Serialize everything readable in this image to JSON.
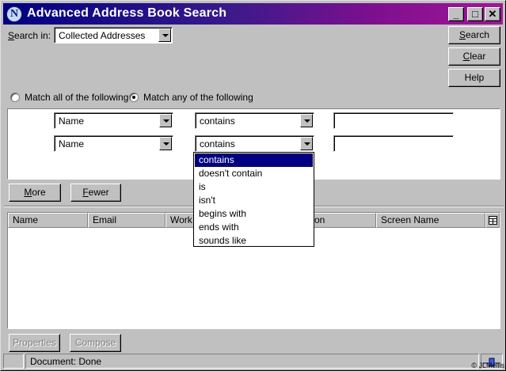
{
  "window": {
    "title": "Advanced Address Book Search",
    "app_icon_letter": "N",
    "minimize": "_",
    "maximize": "□",
    "close": "✕"
  },
  "search_in": {
    "label_prefix": "S",
    "label_rest": "earch in:",
    "value": "Collected Addresses"
  },
  "buttons": {
    "search_u": "S",
    "search_rest": "earch",
    "clear_u": "C",
    "clear_rest": "lear",
    "help": "Help",
    "more_u": "M",
    "more_rest": "ore",
    "fewer_u": "F",
    "fewer_rest": "ewer",
    "properties": "Properties",
    "compose": "Compose"
  },
  "match": {
    "all_label": "Match all of the following",
    "any_label": "Match any of the following",
    "selected": "any"
  },
  "criteria": [
    {
      "field": "Name",
      "operator": "contains",
      "value": ""
    },
    {
      "field": "Name",
      "operator": "contains",
      "value": ""
    }
  ],
  "operator_dropdown": {
    "options": [
      "contains",
      "doesn't contain",
      "is",
      "isn't",
      "begins with",
      "ends with",
      "sounds like"
    ],
    "selected_index": 0
  },
  "results": {
    "columns": [
      "Name",
      "Email",
      "Work",
      "on",
      "Screen Name"
    ]
  },
  "status": {
    "text": "Document: Done",
    "credit": "© JLMellis"
  },
  "icons": [
    "netscape-n-icon",
    "minimize-icon",
    "maximize-icon",
    "close-icon",
    "chevron-down-icon",
    "column-picker-icon",
    "security-icon"
  ]
}
